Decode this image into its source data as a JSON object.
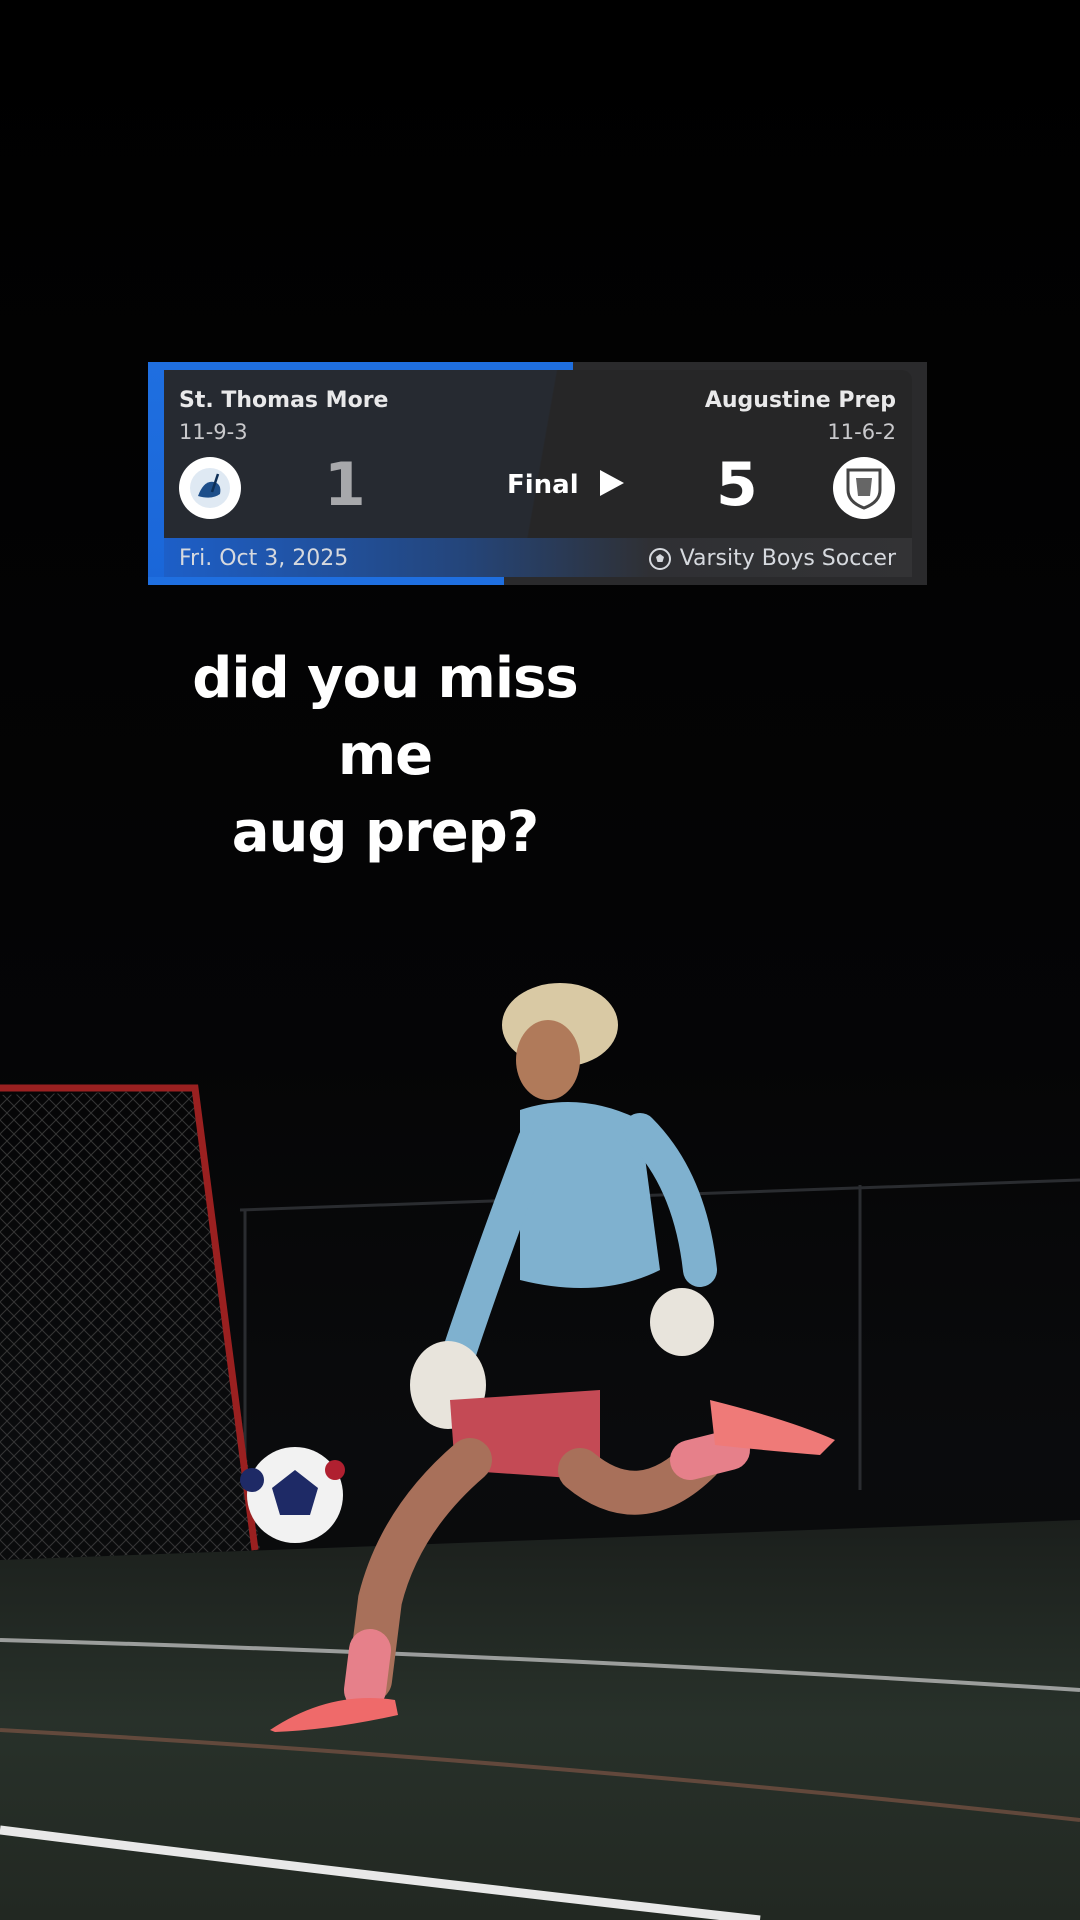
{
  "scorecard": {
    "home": {
      "name": "St. Thomas More",
      "record": "11-9-3",
      "score": "1"
    },
    "away": {
      "name": "Augustine Prep",
      "record": "11-6-2",
      "score": "5"
    },
    "status": "Final",
    "date": "Fri. Oct 3, 2025",
    "sport": "Varsity Boys Soccer",
    "sport_icon": "soccer-ball-icon",
    "accent_color": "#1f6fe0"
  },
  "caption": {
    "line1": "did you miss me",
    "line2": "aug prep?"
  }
}
